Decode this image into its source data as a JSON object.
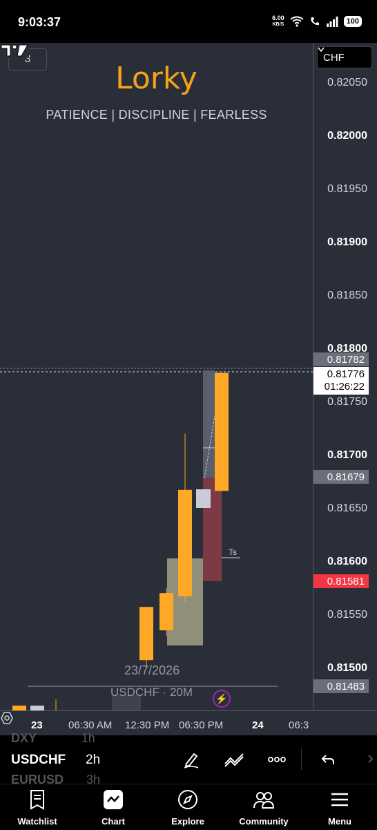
{
  "status_bar": {
    "time": "9:03:37",
    "net_speed_value": "6.00",
    "net_speed_unit": "KB/S",
    "battery": "100"
  },
  "chart_header": {
    "layers_count": "3",
    "brand": "Lorky",
    "tagline": "PATIENCE | DISCIPLINE | FEARLESS"
  },
  "symbol_select": {
    "value": "CHF"
  },
  "price_axis": {
    "labels": [
      {
        "text": "0.82050",
        "bold": false
      },
      {
        "text": "0.82000",
        "bold": true
      },
      {
        "text": "0.81950",
        "bold": false
      },
      {
        "text": "0.81900",
        "bold": true
      },
      {
        "text": "0.81850",
        "bold": false
      },
      {
        "text": "0.81800",
        "bold": true
      },
      {
        "text": "0.81750",
        "bold": false
      },
      {
        "text": "0.81700",
        "bold": true
      },
      {
        "text": "0.81650",
        "bold": false
      },
      {
        "text": "0.81600",
        "bold": true
      },
      {
        "text": "0.81550",
        "bold": false
      },
      {
        "text": "0.81500",
        "bold": true
      }
    ],
    "tags": {
      "high": "0.81782",
      "last_price": "0.81776",
      "countdown": "01:26:22",
      "level_1": "0.81679",
      "level_red": "0.81581",
      "level_2": "0.81483"
    }
  },
  "watermark": {
    "date": "23/7/2026",
    "symbol": "USDCHF · 20M"
  },
  "annotation": {
    "ts_label": "Ts"
  },
  "time_axis": {
    "labels": [
      "23",
      "06:30 AM",
      "12:30 PM",
      "06:30 PM",
      "24",
      "06:3"
    ]
  },
  "colors": {
    "bull": "#ffa726",
    "background": "#2a2e39",
    "accent": "#f7a21b",
    "red_tag": "#f23645"
  },
  "chart_data": {
    "type": "candlestick",
    "symbol": "USDCHF",
    "y_range": [
      0.81465,
      0.82085
    ],
    "candles": [
      {
        "open": 0.81507,
        "close": 0.81557,
        "high": 0.81557,
        "low": 0.815
      },
      {
        "open": 0.81535,
        "close": 0.8157,
        "high": 0.81575,
        "low": 0.8153
      },
      {
        "open": 0.81567,
        "close": 0.81667,
        "high": 0.8172,
        "low": 0.81562
      },
      {
        "open": 0.81666,
        "close": 0.81777,
        "high": 0.81777,
        "low": 0.81666
      }
    ]
  },
  "toolbar": {
    "ghost_top": "DXY",
    "ghost_interval_top": "1h",
    "symbol": "USDCHF",
    "interval": "2h",
    "ghost_bottom": "EURUSD",
    "ghost_interval_bottom": "3h"
  },
  "nav": {
    "watchlist": "Watchlist",
    "chart": "Chart",
    "explore": "Explore",
    "community": "Community",
    "menu": "Menu"
  }
}
